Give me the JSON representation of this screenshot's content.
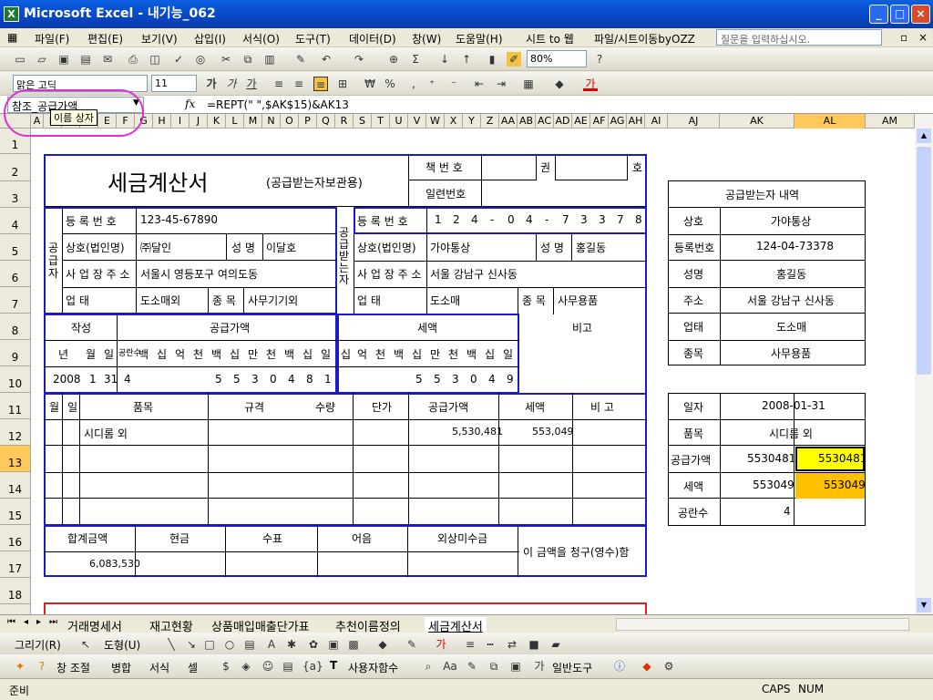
{
  "window": {
    "title": "Microsoft Excel - 내기능_062"
  },
  "menu": [
    "파일(F)",
    "편집(E)",
    "보기(V)",
    "삽입(I)",
    "서식(O)",
    "도구(T)",
    "데이터(D)",
    "창(W)",
    "도움말(H)",
    "시트 to 웹",
    "파일/시트이동byOZZ"
  ],
  "help_box": {
    "placeholder": "질문을 입력하십시오."
  },
  "toolbar": {
    "zoom": "80%",
    "font": "맑은 고딕",
    "size": "11",
    "bold": "가",
    "italic": "가",
    "underline": "가",
    "won": "₩",
    "percent": "%",
    "comma": ","
  },
  "formula_bar": {
    "name": "참조_공급가액",
    "formula": "=REPT(\" \",$AK$15)&AK13",
    "fx": "fx",
    "tooltip": "이름 상자"
  },
  "columns": [
    "A",
    "B",
    "C",
    "D",
    "E",
    "F",
    "G",
    "H",
    "I",
    "J",
    "K",
    "L",
    "M",
    "N",
    "O",
    "P",
    "Q",
    "R",
    "S",
    "T",
    "U",
    "V",
    "W",
    "X",
    "Y",
    "Z",
    "AA",
    "AB",
    "AC",
    "AD",
    "AE",
    "AF",
    "AG",
    "AH",
    "AI",
    "AJ",
    "AK",
    "AL",
    "AM"
  ],
  "rows": [
    "1",
    "2",
    "3",
    "4",
    "5",
    "6",
    "7",
    "8",
    "9",
    "10",
    "11",
    "12",
    "13",
    "14",
    "15",
    "16",
    "17",
    "18"
  ],
  "invoice": {
    "title": "세금계산서",
    "subtitle": "(공급받는자보관용)",
    "book_no": "책 번 호",
    "gwon": "권",
    "ho": "호",
    "serial": "일련번호",
    "supplier_vertical": "공급자",
    "receiver_vertical": "공급받는자",
    "reg_label": "등 록 번 호",
    "reg_no": "123-45-67890",
    "name_label": "상호(법인명)",
    "name": "㈜달인",
    "rep_label": "성 명",
    "rep": "이달호",
    "addr_label": "사 업 장 주 소",
    "addr": "서울시 영등포구 여의도동",
    "biz_label": "업 태",
    "biz": "도소매외",
    "item_label": "종 목",
    "item": "사무기기외",
    "recv_reg_digits": [
      "1",
      "2",
      "4",
      "-",
      "0",
      "4",
      "-",
      "7",
      "3",
      "3",
      "7",
      "8"
    ],
    "recv_name": "가야통상",
    "recv_rep": "홍길동",
    "recv_addr": "서울 강남구 신사동",
    "recv_biz": "도소매",
    "recv_item": "사무용품",
    "written": "작성",
    "supply": "공급가액",
    "tax": "세액",
    "note": "비고",
    "date_heads": [
      "년",
      "월",
      "일"
    ],
    "blank_count": "공란수",
    "amount_heads": [
      "백",
      "십",
      "억",
      "천",
      "백",
      "십",
      "만",
      "천",
      "백",
      "십",
      "일"
    ],
    "tax_heads": [
      "십",
      "억",
      "천",
      "백",
      "십",
      "만",
      "천",
      "백",
      "십",
      "일"
    ],
    "year": "2008",
    "month": "1",
    "day": "31",
    "blanks": "4",
    "supply_digits": [
      "",
      "",
      "",
      "",
      "5",
      "5",
      "3",
      "0",
      "4",
      "8",
      "1"
    ],
    "tax_digits": [
      "",
      "",
      "",
      "",
      "5",
      "5",
      "3",
      "0",
      "4",
      "9"
    ],
    "line_heads": [
      "월",
      "일",
      "품목",
      "규격",
      "수량",
      "단가",
      "공급가액",
      "세액",
      "비 고"
    ],
    "line_item": "시디롬 외",
    "line_supply": "5,530,481",
    "line_tax": "553,049",
    "total_heads": [
      "합계금액",
      "현금",
      "수표",
      "어음",
      "외상미수금"
    ],
    "total": "6,083,530",
    "claim": "이 금액을 청구(영수)함"
  },
  "side_table": {
    "header": "공급받는자 내역",
    "rows": [
      [
        "상호",
        "가야통상"
      ],
      [
        "등록번호",
        "124-04-73378"
      ],
      [
        "성명",
        "홍길동"
      ],
      [
        "주소",
        "서울 강남구 신사동"
      ],
      [
        "업태",
        "도소매"
      ],
      [
        "종목",
        "사무용품"
      ]
    ],
    "date_label": "일자",
    "date": "2008-01-31",
    "item_label": "품목",
    "item": "시디롬 외",
    "supply_label": "공급가액",
    "supply_ak": "5530481",
    "supply_al": "5530481",
    "tax_label": "세액",
    "tax_ak": "553049",
    "tax_al": "553049",
    "blank_label": "공란수",
    "blank": "4"
  },
  "sheet_tabs": [
    "거래명세서",
    "재고현황",
    "상품매입매출단가표",
    "추천이름정의",
    "세금계산서"
  ],
  "drawing": {
    "draw": "그리기(R)",
    "shapes": "도형(U)"
  },
  "ext_toolbar": [
    "창 조절",
    "병합",
    "서식",
    "셀",
    "사용자함수",
    "일반도구"
  ],
  "status": {
    "left": "준비",
    "caps": "CAPS",
    "num": "NUM"
  },
  "colors": {
    "highlight_yellow": "#ffff00",
    "highlight_orange": "#ffc000",
    "border_blue": "#1a1ac8",
    "selection": "#ffc85a"
  }
}
